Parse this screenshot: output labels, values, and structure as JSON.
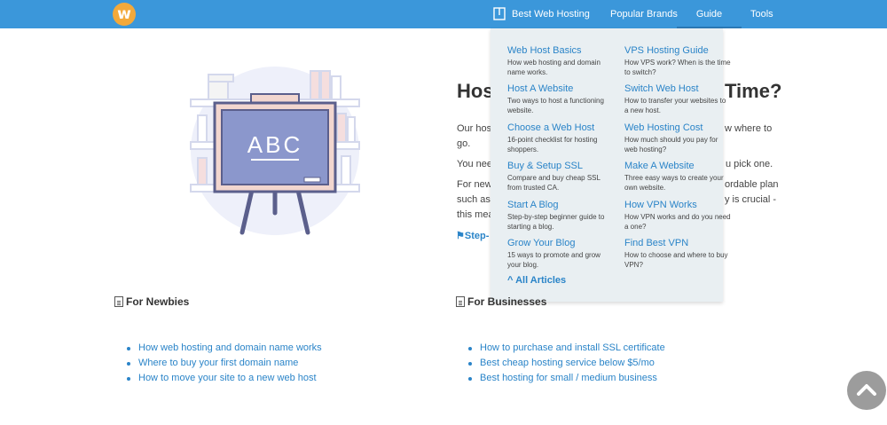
{
  "brand": {
    "logo_letter": "w"
  },
  "nav": {
    "items": [
      {
        "label": "Best Web Hosting"
      },
      {
        "label": "Popular Brands"
      },
      {
        "label": "Guide"
      },
      {
        "label": "Tools"
      }
    ]
  },
  "hero": {
    "title_start": "Hos",
    "title_end": "Time?",
    "illustration_text": "ABC",
    "para1_a": "Our hos",
    "para1_b": "w where to",
    "para1_c": "go.",
    "para2_a": "You nee",
    "para2_b": "u pick one.",
    "para3_a": "For new",
    "para3_b": "ordable plan",
    "para3_c": "such as",
    "para3_d": "y is crucial -",
    "para3_e": "this mea",
    "step_link": "Step-"
  },
  "dropdown": {
    "items": [
      {
        "title": "Web Host Basics",
        "desc": "How web hosting and domain name works."
      },
      {
        "title": "VPS Hosting Guide",
        "desc": "How VPS work? When is the time to switch?"
      },
      {
        "title": "Host A Website",
        "desc": "Two ways to host a functioning website."
      },
      {
        "title": "Switch Web Host",
        "desc": "How to transfer your websites to a new host."
      },
      {
        "title": "Choose a Web Host",
        "desc": "16-point checklist for hosting shoppers."
      },
      {
        "title": "Web Hosting Cost",
        "desc": "How much should you pay for web hosting?"
      },
      {
        "title": "Buy & Setup SSL",
        "desc": "Compare and buy cheap SSL from trusted CA."
      },
      {
        "title": "Make A Website",
        "desc": "Three easy ways to create your own website."
      },
      {
        "title": "Start A Blog",
        "desc": "Step-by-step beginner guide to starting a blog."
      },
      {
        "title": "How VPN Works",
        "desc": "How VPN works and do you need a one?"
      },
      {
        "title": "Grow Your Blog",
        "desc": "15 ways to promote and grow your blog."
      },
      {
        "title": "Find Best VPN",
        "desc": "How to choose and where to buy VPN?"
      }
    ],
    "all_articles": "^ All Articles"
  },
  "newbies": {
    "heading": "For Newbies",
    "links": [
      "How web hosting and domain name works",
      "Where to buy your first domain name",
      "How to move your site to a new web host"
    ]
  },
  "businesses": {
    "heading": "For Businesses",
    "links": [
      "How to purchase and install SSL certificate",
      "Best cheap hosting service below $5/mo",
      "Best hosting for small / medium business"
    ]
  },
  "icons": {
    "logo": "logo-icon",
    "nav_book": "book-icon",
    "doc": "document-icon",
    "scroll_top": "chevron-up-icon"
  },
  "colors": {
    "nav_bg": "#3b97da",
    "link": "#2a84c8",
    "logo": "#f3a93b",
    "dropdown_bg": "#e9eff2",
    "board": "#8b97cc"
  }
}
